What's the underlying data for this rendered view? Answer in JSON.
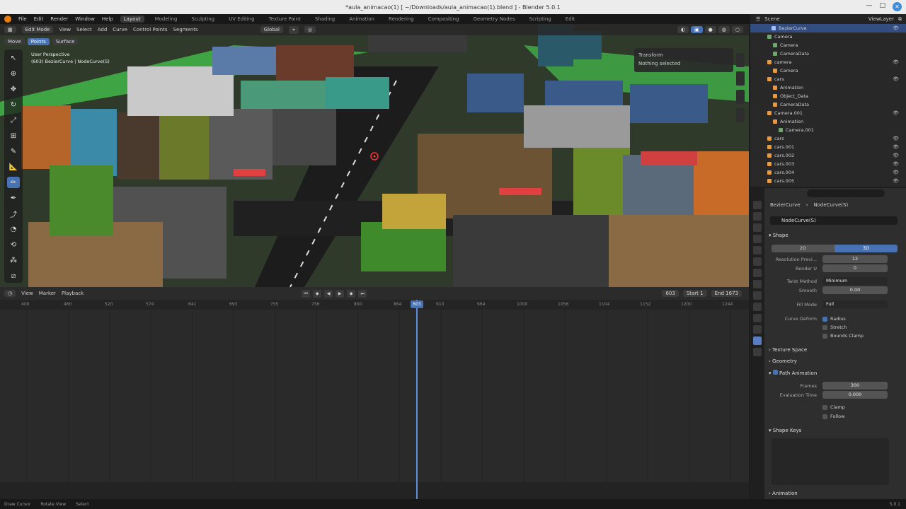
{
  "window": {
    "title": "*aula_animacao(1) [ ~/Downloads/aula_animacao(1).blend ] - Blender 5.0.1"
  },
  "menu": [
    "File",
    "Edit",
    "Render",
    "Window",
    "Help"
  ],
  "workspaces": [
    "Layout",
    "Modeling",
    "Sculpting",
    "UV Editing",
    "Texture Paint",
    "Shading",
    "Animation",
    "Rendering",
    "Compositing",
    "Geometry Nodes",
    "Scripting",
    "Edit"
  ],
  "scene_name": "Scene",
  "view_layer": "ViewLayer",
  "viewport": {
    "mode": "Edit Mode",
    "menus": [
      "View",
      "Select",
      "Add",
      "Curve",
      "Control Points",
      "Segments"
    ],
    "transform_orientation": "Global",
    "sub_tabs": [
      "Move",
      "Points",
      "Surface"
    ],
    "info_line1": "User Perspective",
    "info_line2": "(603) BezierCurve | NodeCurve(S)",
    "popup_item1": "Transform",
    "popup_item2": "Nothing selected"
  },
  "timeline": {
    "menus": [
      "View",
      "Marker",
      "Playback"
    ],
    "current_frame": "603",
    "start_label": "Start",
    "start": "1",
    "end_label": "End",
    "end": "1673",
    "ruler": [
      "400",
      "460",
      "520",
      "574",
      "641",
      "693",
      "755",
      "756",
      "850",
      "864",
      "910",
      "964",
      "1000",
      "1056",
      "1104",
      "1152",
      "1200",
      "1244"
    ]
  },
  "outliner": {
    "rows": [
      {
        "label": "BezierCurve",
        "color": "#a0c0ff",
        "indent": 30,
        "sel": true
      },
      {
        "label": "Camera",
        "color": "#6fa86f",
        "indent": 24,
        "sel": false
      },
      {
        "label": "Camera",
        "color": "#6fa86f",
        "indent": 32,
        "sel": false
      },
      {
        "label": "CameraData",
        "color": "#6fa86f",
        "indent": 32,
        "sel": false
      },
      {
        "label": "camera",
        "color": "#e89a3c",
        "indent": 24,
        "sel": false
      },
      {
        "label": "Camera",
        "color": "#e89a3c",
        "indent": 32,
        "sel": false
      },
      {
        "label": "cars",
        "color": "#e89a3c",
        "indent": 24,
        "sel": false
      },
      {
        "label": "Animation",
        "color": "#e89a3c",
        "indent": 32,
        "sel": false
      },
      {
        "label": "Object_Data",
        "color": "#e89a3c",
        "indent": 32,
        "sel": false
      },
      {
        "label": "CameraData",
        "color": "#e89a3c",
        "indent": 32,
        "sel": false
      },
      {
        "label": "Camera.001",
        "color": "#e89a3c",
        "indent": 24,
        "sel": false
      },
      {
        "label": "Animation",
        "color": "#e89a3c",
        "indent": 32,
        "sel": false
      },
      {
        "label": "Camera.001",
        "color": "#6fa86f",
        "indent": 40,
        "sel": false
      },
      {
        "label": "cars",
        "color": "#e89a3c",
        "indent": 24,
        "sel": false
      },
      {
        "label": "cars.001",
        "color": "#e89a3c",
        "indent": 24,
        "sel": false
      },
      {
        "label": "cars.002",
        "color": "#e89a3c",
        "indent": 24,
        "sel": false
      },
      {
        "label": "cars.003",
        "color": "#e89a3c",
        "indent": 24,
        "sel": false
      },
      {
        "label": "cars.004",
        "color": "#e89a3c",
        "indent": 24,
        "sel": false
      },
      {
        "label": "cars.005",
        "color": "#e89a3c",
        "indent": 24,
        "sel": false
      }
    ]
  },
  "properties": {
    "crumb1": "BezierCurve",
    "crumb2": "NodeCurve(S)",
    "name": "NodeCurve(S)",
    "shape_title": "Shape",
    "seg_2d": "2D",
    "seg_3d": "3D",
    "res_preview_label": "Resolution Previ...",
    "res_preview": "12",
    "render_u_label": "Render U",
    "render_u": "0",
    "twist_method_label": "Twist Method",
    "twist_method": "Minimum",
    "smooth_label": "Smooth",
    "smooth": "0.00",
    "fill_mode_label": "Fill Mode",
    "fill_mode": "Full",
    "curve_deform_label": "Curve Deform",
    "radius": "Radius",
    "stretch": "Stretch",
    "bounds_clamp": "Bounds Clamp",
    "texture_space": "Texture Space",
    "geometry": "Geometry",
    "path_animation": "Path Animation",
    "frames_label": "Frames",
    "frames": "300",
    "eval_time_label": "Evaluation Time",
    "eval_time": "0.000",
    "clamp": "Clamp",
    "follow": "Follow",
    "shape_keys": "Shape Keys",
    "animation": "Animation"
  },
  "status": {
    "items": [
      "Draw Cursor",
      "Rotate View",
      "Select"
    ],
    "version": "5.0.1"
  }
}
